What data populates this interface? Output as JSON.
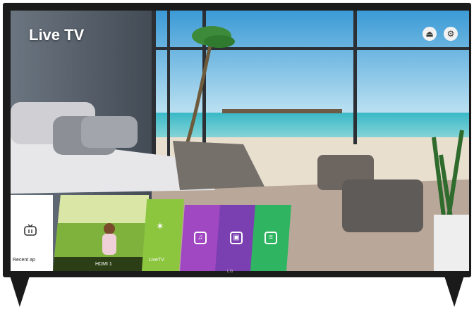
{
  "screen": {
    "title": "Live TV",
    "top_buttons": [
      {
        "name": "input",
        "icon": "input-source-icon",
        "glyph": "⏏"
      },
      {
        "name": "settings",
        "icon": "gear-icon",
        "glyph": "⚙"
      }
    ]
  },
  "launcher": {
    "recent": {
      "label": "Recent ap",
      "icon": "tv-icon"
    },
    "hdmi": {
      "label": "HDMI 1"
    },
    "live_tv": {
      "label": "LiveTV",
      "icon": "antenna-icon",
      "glyph": "✶"
    },
    "music": {
      "icon": "music-icon",
      "glyph": "♫"
    },
    "video": {
      "icon": "video-icon",
      "glyph": "▣"
    },
    "guide": {
      "icon": "guide-tv-icon",
      "glyph": "≡"
    }
  },
  "brand": {
    "logo_text": "LG"
  },
  "colors": {
    "bezel": "#1b1b1b",
    "live_tv_tile": "#8cc63f",
    "music_tile": "#a047c2",
    "video_tile": "#7a3fb0",
    "guide_tile": "#2fb561"
  }
}
